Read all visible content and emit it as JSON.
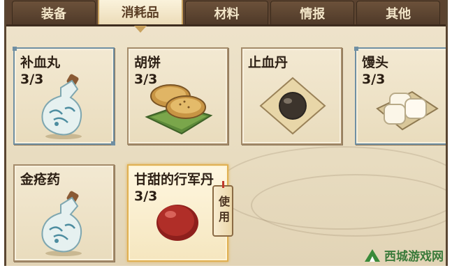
{
  "tabs": [
    {
      "label": "装备",
      "active": false
    },
    {
      "label": "消耗品",
      "active": true
    },
    {
      "label": "材料",
      "active": false
    },
    {
      "label": "情报",
      "active": false
    },
    {
      "label": "其他",
      "active": false
    }
  ],
  "items": [
    {
      "name": "补血丸",
      "count": "3/3",
      "icon": "porcelain-bottle-icon"
    },
    {
      "name": "胡饼",
      "count": "3/3",
      "icon": "flatbread-icon"
    },
    {
      "name": "止血丹",
      "count": "3/3",
      "icon": "black-pill-icon"
    },
    {
      "name": "馒头",
      "count": "3/3",
      "icon": "steamed-bun-icon"
    },
    {
      "name": "金疮药",
      "count": "3/3",
      "icon": "porcelain-bottle-icon"
    },
    {
      "name": "甘甜的行军丹",
      "count": "3/3",
      "icon": "red-pill-icon",
      "selected": true
    }
  ],
  "use_button": {
    "label": "使用"
  },
  "watermark": {
    "text": "西城游戏网",
    "subtext": "XICHENGYOUXIWANG"
  },
  "colors": {
    "tab_bar": "#5b4330",
    "slot_border": "#a48b6a",
    "selected_border": "#e0b052",
    "accent_red": "#c0392b"
  }
}
